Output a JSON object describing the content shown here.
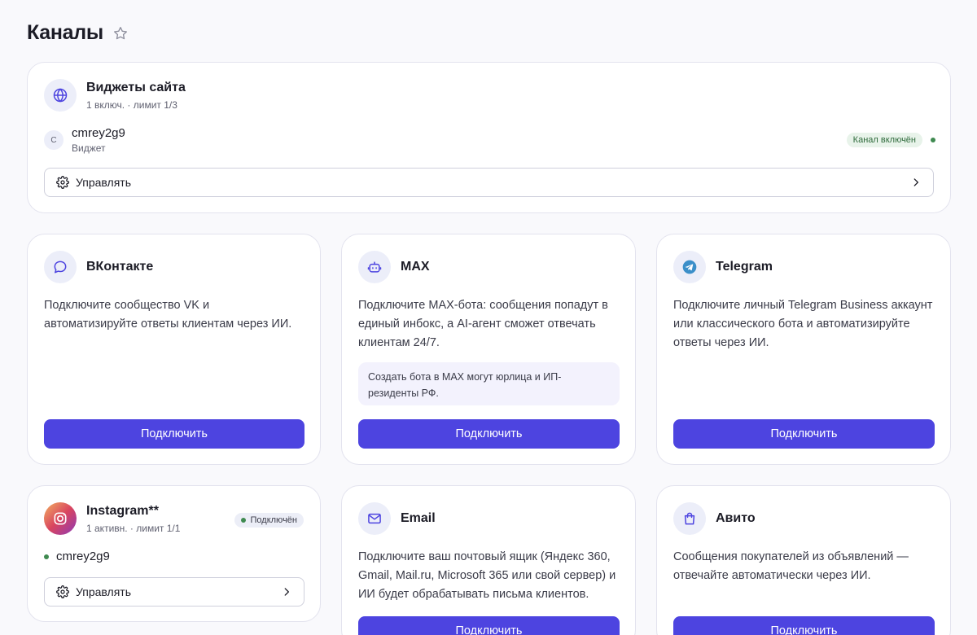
{
  "page": {
    "title": "Каналы"
  },
  "widgets": {
    "title": "Виджеты сайта",
    "subtitle": "1 включ. · лимит 1/3",
    "item": {
      "avatar_letter": "C",
      "name": "cmrey2g9",
      "type": "Виджет"
    },
    "status": "Канал включён",
    "manage_label": "Управлять"
  },
  "vk": {
    "title": "ВКонтакте",
    "description": "Подключите сообщество VK и автоматизируйте ответы клиентам через ИИ.",
    "button": "Подключить"
  },
  "max": {
    "title": "MAX",
    "description": "Подключите MAX-бота: сообщения попадут в единый инбокс, а AI-агент сможет отвечать клиентам 24/7.",
    "note": "Создать бота в MAX могут юрлица и ИП-резиденты РФ.",
    "button": "Подключить"
  },
  "telegram": {
    "title": "Telegram",
    "description": "Подключите личный Telegram Business аккаунт или классического бота и автоматизируйте ответы через ИИ.",
    "button": "Подключить"
  },
  "instagram": {
    "title": "Instagram**",
    "subtitle": "1 активн. · лимит 1/1",
    "status": "Подключён",
    "account": "cmrey2g9",
    "manage_label": "Управлять"
  },
  "email": {
    "title": "Email",
    "description": "Подключите ваш почтовый ящик (Яндекс 360, Gmail, Mail.ru, Microsoft 365 или свой сервер) и ИИ будет обрабатывать письма клиентов.",
    "button": "Подключить"
  },
  "avito": {
    "title": "Авито",
    "description": "Сообщения покупателей из объявлений — отвечайте автоматически через ИИ.",
    "button": "Подключить"
  },
  "colors": {
    "accent": "#4d44e0",
    "status_green": "#3f8a50",
    "icon_bg": "#eceef9"
  },
  "icons": [
    "star-icon",
    "globe-icon",
    "gear-icon",
    "chevron-right-icon",
    "chat-bubble-icon",
    "robot-icon",
    "telegram-icon",
    "instagram-icon",
    "mail-icon",
    "shopping-bag-icon"
  ]
}
